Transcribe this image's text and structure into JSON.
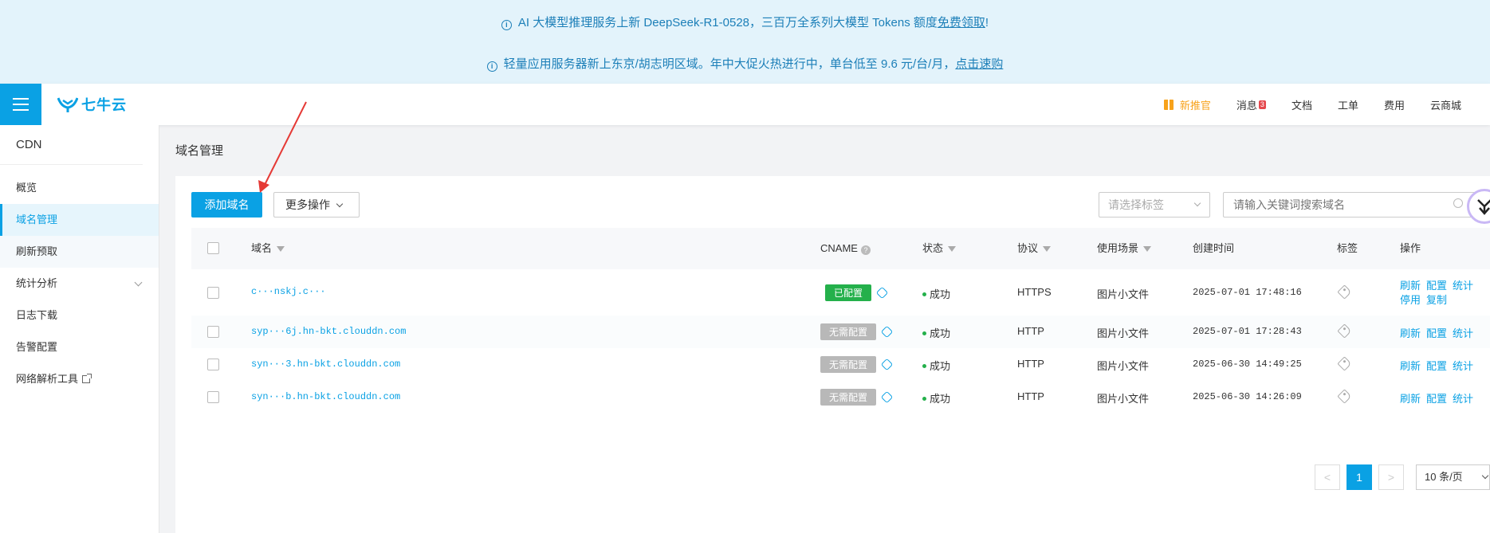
{
  "notices": [
    {
      "text": "AI 大模型推理服务上新 DeepSeek-R1-0528，三百万全系列大模型 Tokens 额度",
      "link": "免费领取",
      "suffix": "!"
    },
    {
      "text": "轻量应用服务器新上东京/胡志明区域。年中大促火热进行中，单台低至 9.6 元/台/月，",
      "link": "点击速购",
      "suffix": ""
    }
  ],
  "header": {
    "logo_text": "七牛云",
    "nav": {
      "promo": "新推官",
      "messages": "消息",
      "messages_count": "3",
      "docs": "文档",
      "tickets": "工单",
      "billing": "费用",
      "market": "云商城"
    }
  },
  "sidebar": {
    "title": "CDN",
    "items": [
      {
        "label": "概览"
      },
      {
        "label": "域名管理"
      },
      {
        "label": "刷新预取"
      },
      {
        "label": "统计分析"
      },
      {
        "label": "日志下载"
      },
      {
        "label": "告警配置"
      },
      {
        "label": "网络解析工具"
      }
    ]
  },
  "main": {
    "title": "域名管理",
    "add_button": "添加域名",
    "more_button": "更多操作",
    "tag_select_placeholder": "请选择标签",
    "search_placeholder": "请输入关键词搜索域名",
    "columns": {
      "domain": "域名",
      "cname": "CNAME",
      "status": "状态",
      "protocol": "协议",
      "scene": "使用场景",
      "created": "创建时间",
      "tags": "标签",
      "ops": "操作"
    },
    "rows": [
      {
        "domain": "c···nskj.c···",
        "cname": "已配置",
        "status": "成功",
        "protocol": "HTTPS",
        "scene": "图片小文件",
        "created": "2025-07-01 17:48:16",
        "ops": [
          "刷新",
          "配置",
          "统计"
        ],
        "ops2": [
          "停用",
          "复制"
        ]
      },
      {
        "domain": "syp···6j.hn-bkt.clouddn.com",
        "cname": "无需配置",
        "status": "成功",
        "protocol": "HTTP",
        "scene": "图片小文件",
        "created": "2025-07-01 17:28:43",
        "ops": [
          "刷新",
          "配置",
          "统计"
        ]
      },
      {
        "domain": "syn···3.hn-bkt.clouddn.com",
        "cname": "无需配置",
        "status": "成功",
        "protocol": "HTTP",
        "scene": "图片小文件",
        "created": "2025-06-30 14:49:25",
        "ops": [
          "刷新",
          "配置",
          "统计"
        ]
      },
      {
        "domain": "syn···b.hn-bkt.clouddn.com",
        "cname": "无需配置",
        "status": "成功",
        "protocol": "HTTP",
        "scene": "图片小文件",
        "created": "2025-06-30 14:26:09",
        "ops": [
          "刷新",
          "配置",
          "统计"
        ]
      }
    ],
    "pagination": {
      "prev": "<",
      "current": "1",
      "next": ">",
      "page_size": "10 条/页"
    }
  },
  "colors": {
    "accent": "#0aa1e4",
    "success": "#24b04b",
    "promo": "#f7a21b",
    "annotation": "#e53935"
  }
}
